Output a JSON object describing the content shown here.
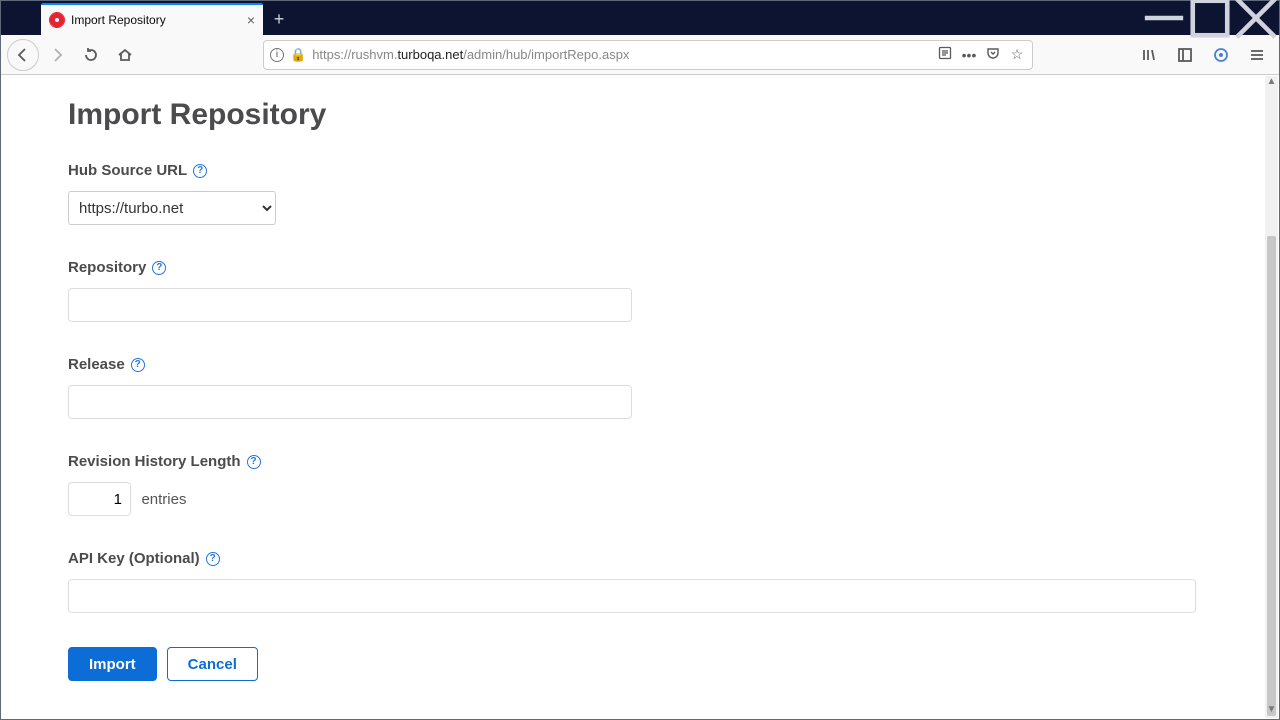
{
  "browser": {
    "tab_title": "Import Repository",
    "url_html": "https://rushvm.<span class='host'>turboqa.net</span>/admin/hub/importRepo.aspx",
    "url_plain": "https://rushvm.turboqa.net/admin/hub/importRepo.aspx"
  },
  "page": {
    "title": "Import Repository",
    "labels": {
      "hub_source": "Hub Source URL",
      "repository": "Repository",
      "release": "Release",
      "revision": "Revision History Length",
      "apikey": "API Key (Optional)"
    },
    "hub_source_value": "https://turbo.net",
    "repository_value": "",
    "release_value": "",
    "revision_value": "1",
    "revision_suffix": "entries",
    "apikey_value": "",
    "buttons": {
      "primary": "Import",
      "secondary": "Cancel"
    }
  }
}
